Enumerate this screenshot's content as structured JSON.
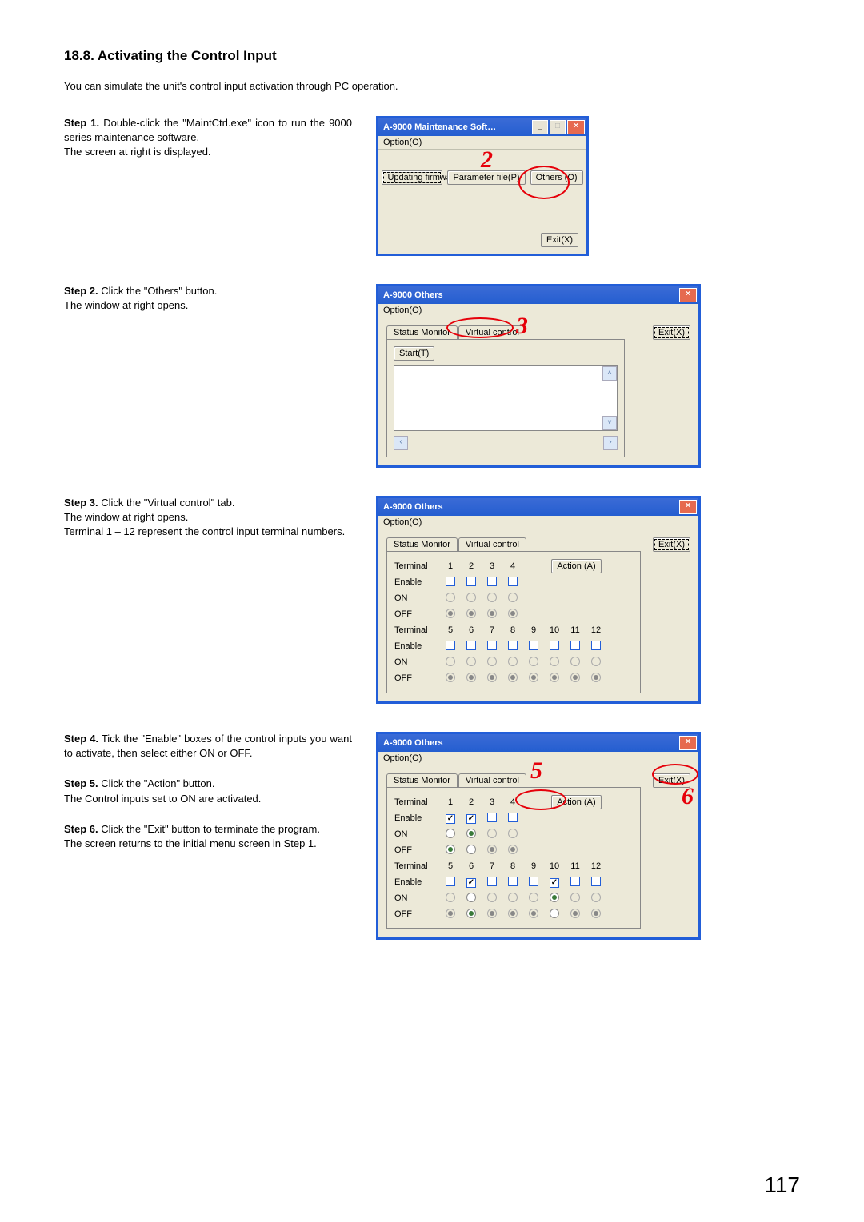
{
  "section": {
    "heading": "18.8. Activating the Control Input",
    "intro": "You can simulate the unit's control input activation through PC operation."
  },
  "steps": {
    "s1": {
      "label": "Step 1.",
      "body1": "Double-click the \"MaintCtrl.exe\" icon to run the 9000 series maintenance software.",
      "body2": "The screen at right is displayed."
    },
    "s2": {
      "label": "Step 2.",
      "body1": "Click the \"Others\" button.",
      "body2": "The window at right opens."
    },
    "s3": {
      "label": "Step 3.",
      "body1": "Click the \"Virtual control\" tab.",
      "body2": "The window at right opens.",
      "body3": "Terminal 1 – 12 represent the control input terminal numbers."
    },
    "s4": {
      "label": "Step 4.",
      "body": "Tick the \"Enable\" boxes of the control inputs you want to activate, then select either ON or OFF."
    },
    "s5": {
      "label": "Step 5.",
      "body1": "Click the \"Action\" button.",
      "body2": "The Control inputs set to ON are activated."
    },
    "s6": {
      "label": "Step 6.",
      "body1": "Click the \"Exit\" button to terminate the program.",
      "body2": "The screen returns to the initial menu screen in Step 1."
    }
  },
  "win1": {
    "title": "A-9000 Maintenance Soft…",
    "menu_option": "Option(O)",
    "btn_update": "Updating firmware(U)",
    "btn_param": "Parameter file(P)",
    "btn_others": "Others (O)",
    "btn_exit": "Exit(X)",
    "callout": "2"
  },
  "win2": {
    "title": "A-9000 Others",
    "menu_option": "Option(O)",
    "tab_status": "Status Monitor",
    "tab_virtual": "Virtual control",
    "btn_exit": "Exit(X)",
    "btn_start": "Start(T)",
    "callout": "3"
  },
  "win3": {
    "title": "A-9000 Others",
    "menu_option": "Option(O)",
    "tab_status": "Status Monitor",
    "tab_virtual": "Virtual control",
    "btn_exit": "Exit(X)",
    "btn_action": "Action (A)",
    "labels": {
      "terminal": "Terminal",
      "enable": "Enable",
      "on": "ON",
      "off": "OFF"
    },
    "cols_a": [
      "1",
      "2",
      "3",
      "4"
    ],
    "cols_b": [
      "5",
      "6",
      "7",
      "8",
      "9",
      "10",
      "11",
      "12"
    ]
  },
  "win4": {
    "title": "A-9000 Others",
    "menu_option": "Option(O)",
    "tab_status": "Status Monitor",
    "tab_virtual": "Virtual control",
    "btn_exit": "Exit(X)",
    "btn_action": "Action (A)",
    "labels": {
      "terminal": "Terminal",
      "enable": "Enable",
      "on": "ON",
      "off": "OFF"
    },
    "cols_a": [
      "1",
      "2",
      "3",
      "4"
    ],
    "cols_b": [
      "5",
      "6",
      "7",
      "8",
      "9",
      "10",
      "11",
      "12"
    ],
    "callout5": "5",
    "callout6": "6"
  },
  "page_number": "117"
}
